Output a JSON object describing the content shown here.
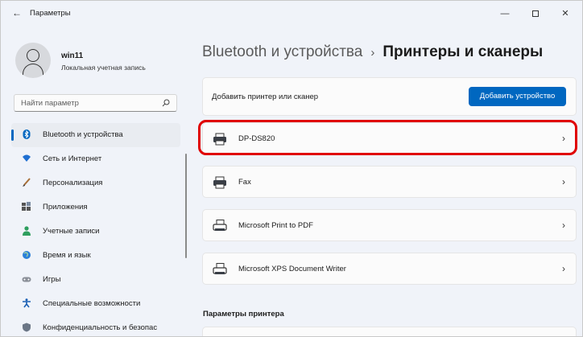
{
  "window": {
    "title": "Параметры",
    "back_glyph": "←",
    "min_glyph": "—",
    "close_glyph": "✕"
  },
  "profile": {
    "name": "win11",
    "account_type": "Локальная учетная запись"
  },
  "search": {
    "placeholder": "Найти параметр"
  },
  "sidebar": {
    "items": [
      {
        "label": "Bluetooth и устройства",
        "icon": "bluetooth-icon",
        "active": true
      },
      {
        "label": "Сеть и Интернет",
        "icon": "wifi-icon"
      },
      {
        "label": "Персонализация",
        "icon": "brush-icon"
      },
      {
        "label": "Приложения",
        "icon": "apps-icon"
      },
      {
        "label": "Учетные записи",
        "icon": "person-icon"
      },
      {
        "label": "Время и язык",
        "icon": "globe-icon"
      },
      {
        "label": "Игры",
        "icon": "gamepad-icon"
      },
      {
        "label": "Специальные возможности",
        "icon": "accessibility-icon"
      },
      {
        "label": "Конфиденциальность и безопас",
        "icon": "shield-icon"
      }
    ]
  },
  "breadcrumb": {
    "parent": "Bluetooth и устройства",
    "separator": "›",
    "current": "Принтеры и сканеры"
  },
  "add_device": {
    "label": "Добавить принтер или сканер",
    "button": "Добавить устройство"
  },
  "devices": [
    {
      "name": "DP-DS820",
      "icon": "printer-icon",
      "highlighted": true
    },
    {
      "name": "Fax",
      "icon": "printer-icon"
    },
    {
      "name": "Microsoft Print to PDF",
      "icon": "pdf-printer-icon"
    },
    {
      "name": "Microsoft XPS Document Writer",
      "icon": "pdf-printer-icon"
    }
  ],
  "chevron_glyph": "›",
  "printer_settings": {
    "title": "Параметры принтера"
  },
  "colors": {
    "accent": "#0067c0",
    "highlight": "#e00000"
  }
}
